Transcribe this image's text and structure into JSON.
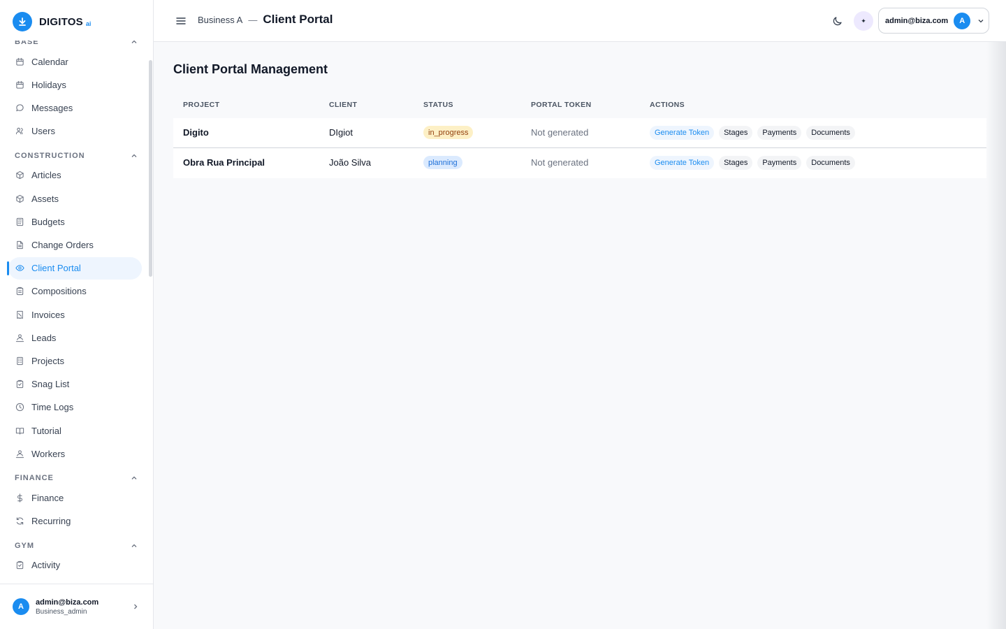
{
  "brand": {
    "name": "DIGITOS",
    "suffix": "ai"
  },
  "sidebar": {
    "partial_section": "BASE",
    "sections": [
      {
        "title": "",
        "items": [
          {
            "label": "Calendar",
            "icon": "calendar-icon"
          },
          {
            "label": "Holidays",
            "icon": "calendar-icon"
          },
          {
            "label": "Messages",
            "icon": "chat-bubble-icon"
          },
          {
            "label": "Users",
            "icon": "users-icon"
          }
        ]
      },
      {
        "title": "CONSTRUCTION",
        "items": [
          {
            "label": "Articles",
            "icon": "cube-icon"
          },
          {
            "label": "Assets",
            "icon": "cube-icon"
          },
          {
            "label": "Budgets",
            "icon": "calculator-icon"
          },
          {
            "label": "Change Orders",
            "icon": "document-icon"
          },
          {
            "label": "Client Portal",
            "icon": "eye-icon",
            "active": true
          },
          {
            "label": "Compositions",
            "icon": "clipboard-icon"
          },
          {
            "label": "Invoices",
            "icon": "receipt-icon"
          },
          {
            "label": "Leads",
            "icon": "user-group-icon"
          },
          {
            "label": "Projects",
            "icon": "building-icon"
          },
          {
            "label": "Snag List",
            "icon": "clipboard-check-icon"
          },
          {
            "label": "Time Logs",
            "icon": "clock-icon"
          },
          {
            "label": "Tutorial",
            "icon": "book-icon"
          },
          {
            "label": "Workers",
            "icon": "user-group-icon"
          }
        ]
      },
      {
        "title": "FINANCE",
        "items": [
          {
            "label": "Finance",
            "icon": "dollar-icon"
          },
          {
            "label": "Recurring",
            "icon": "refresh-icon"
          }
        ]
      },
      {
        "title": "GYM",
        "items": [
          {
            "label": "Activity",
            "icon": "clipboard-check-icon"
          }
        ]
      }
    ],
    "user": {
      "initial": "A",
      "email": "admin@biza.com",
      "role": "Business_admin"
    }
  },
  "header": {
    "business": "Business A",
    "separator": "—",
    "page": "Client Portal",
    "spark": "✦",
    "account_email": "admin@biza.com",
    "account_initial": "A"
  },
  "main": {
    "title": "Client Portal Management",
    "columns": [
      "PROJECT",
      "CLIENT",
      "STATUS",
      "PORTAL TOKEN",
      "ACTIONS"
    ],
    "rows": [
      {
        "project": "Digito",
        "client": "DIgiot",
        "status": "in_progress",
        "token": "Not generated"
      },
      {
        "project": "Obra Rua Principal",
        "client": "João Silva",
        "status": "planning",
        "token": "Not generated"
      }
    ],
    "actions": [
      "Generate Token",
      "Stages",
      "Payments",
      "Documents"
    ]
  },
  "colors": {
    "accent": "#1a8cf0",
    "in_progress_bg": "#fdf0c6",
    "planning_bg": "#dbeafe"
  }
}
